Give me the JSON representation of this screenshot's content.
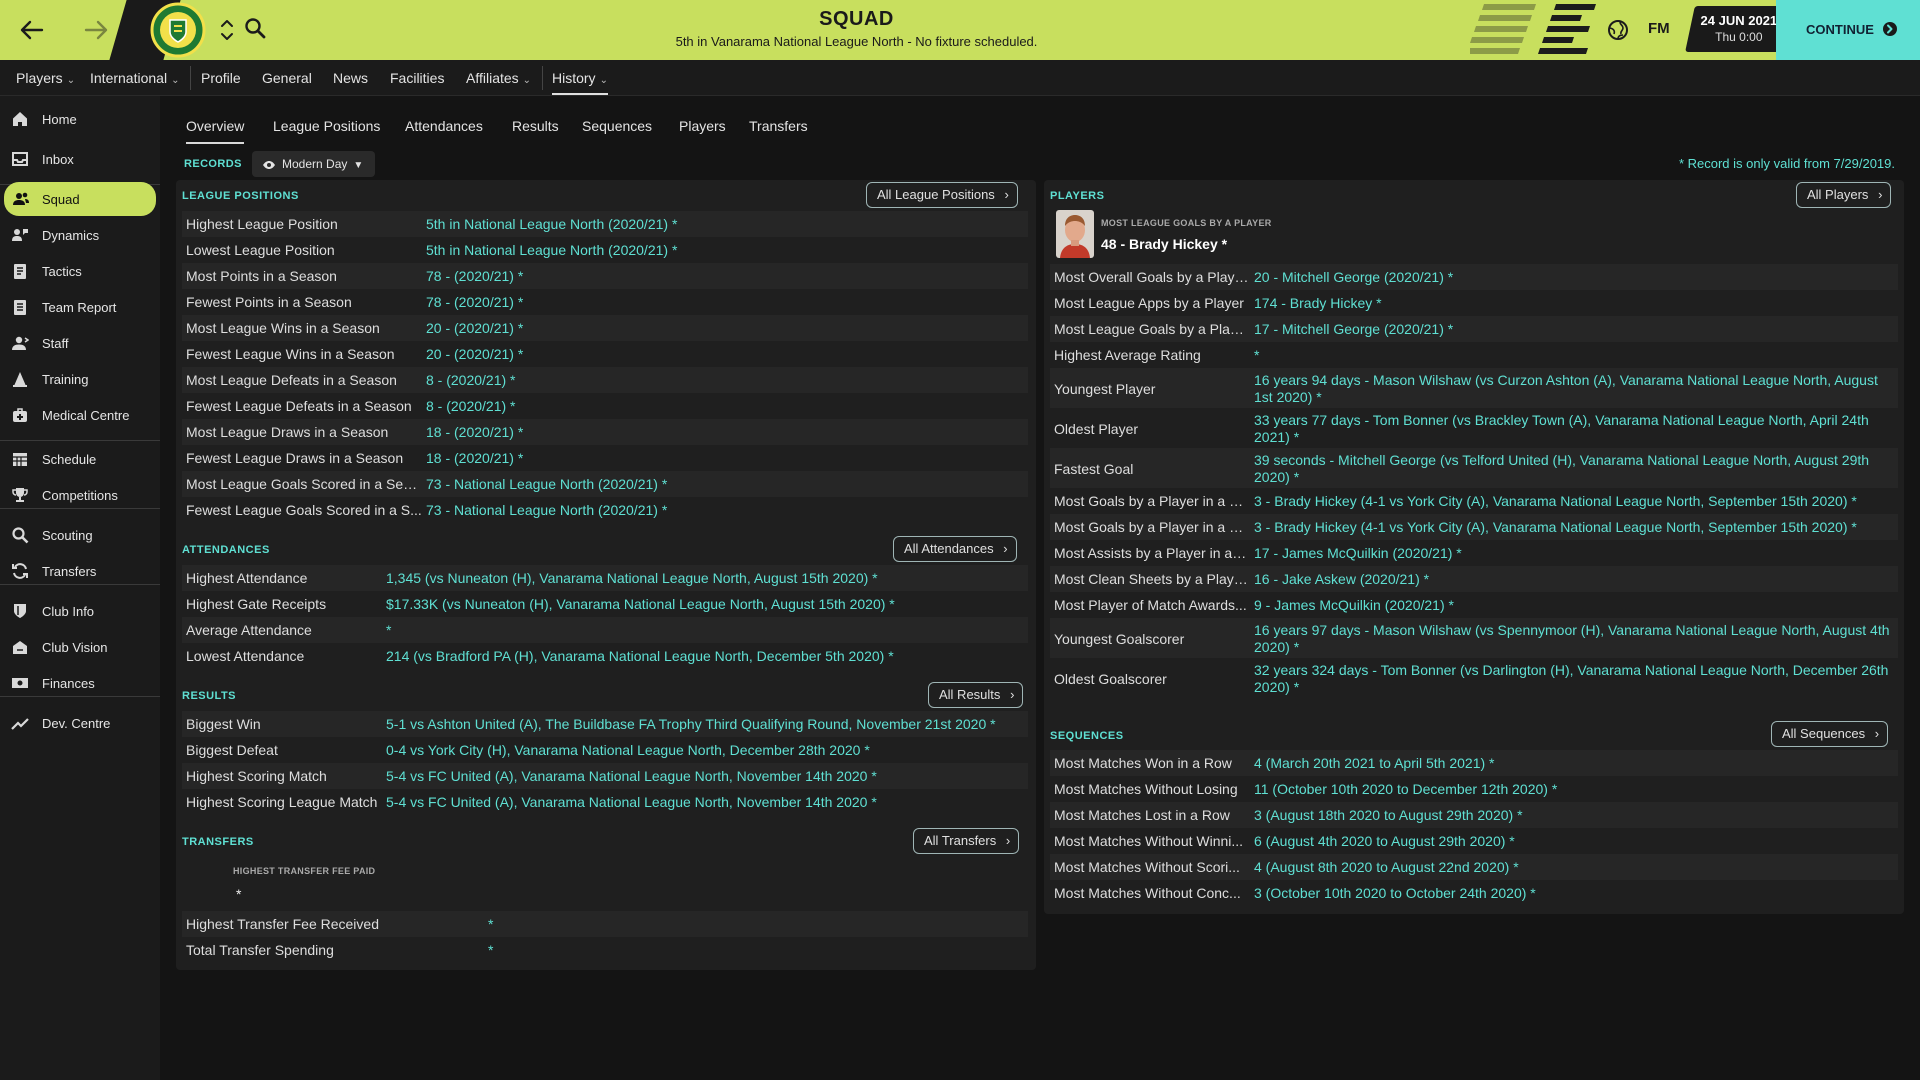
{
  "topbar": {
    "title": "SQUAD",
    "subtitle": "5th in Vanarama National League North - No fixture scheduled.",
    "fm": "FM",
    "date": "24 JUN 2021",
    "time": "Thu 0:00",
    "continue_label": "CONTINUE",
    "accent": "#c8df5e",
    "continue_color": "#5fe0d3"
  },
  "menu": [
    {
      "label": "Players",
      "dropdown": true
    },
    {
      "label": "International",
      "dropdown": true
    },
    {
      "label": "Profile"
    },
    {
      "label": "General"
    },
    {
      "label": "News"
    },
    {
      "label": "Facilities"
    },
    {
      "label": "Affiliates",
      "dropdown": true
    },
    {
      "label": "History",
      "dropdown": true,
      "active": true
    }
  ],
  "sidebar": [
    {
      "label": "Home",
      "icon": "home-icon"
    },
    {
      "label": "Inbox",
      "icon": "inbox-icon"
    },
    {
      "label": "Squad",
      "icon": "squad-icon",
      "active": true
    },
    {
      "label": "Dynamics",
      "icon": "dynamics-icon"
    },
    {
      "label": "Tactics",
      "icon": "tactics-icon"
    },
    {
      "label": "Team Report",
      "icon": "report-icon"
    },
    {
      "label": "Staff",
      "icon": "staff-icon"
    },
    {
      "label": "Training",
      "icon": "training-icon"
    },
    {
      "label": "Medical Centre",
      "icon": "medical-icon"
    },
    {
      "label": "Schedule",
      "icon": "calendar-icon"
    },
    {
      "label": "Competitions",
      "icon": "trophy-icon"
    },
    {
      "label": "Scouting",
      "icon": "scouting-icon"
    },
    {
      "label": "Transfers",
      "icon": "transfers-icon"
    },
    {
      "label": "Club Info",
      "icon": "shield-icon"
    },
    {
      "label": "Club Vision",
      "icon": "vision-icon"
    },
    {
      "label": "Finances",
      "icon": "finances-icon"
    },
    {
      "label": "Dev. Centre",
      "icon": "dev-centre-icon"
    }
  ],
  "subtabs": [
    "Overview",
    "League Positions",
    "Attendances",
    "Results",
    "Sequences",
    "Players",
    "Transfers"
  ],
  "records": {
    "label": "RECORDS",
    "filter": "Modern Day",
    "note": "* Record is only valid from 7/29/2019."
  },
  "league_positions": {
    "title": "LEAGUE POSITIONS",
    "button": "All League Positions",
    "rows": [
      {
        "label": "Highest League Position",
        "value": "5th in National League North (2020/21) *"
      },
      {
        "label": "Lowest League Position",
        "value": "5th in National League North (2020/21) *"
      },
      {
        "label": "Most Points in a Season",
        "value": "78 - (2020/21) *"
      },
      {
        "label": "Fewest Points in a Season",
        "value": "78 - (2020/21) *"
      },
      {
        "label": "Most League Wins in a Season",
        "value": "20 - (2020/21) *"
      },
      {
        "label": "Fewest League Wins in a Season",
        "value": "20 - (2020/21) *"
      },
      {
        "label": "Most League Defeats in a Season",
        "value": "8 - (2020/21) *"
      },
      {
        "label": "Fewest League Defeats in a Season",
        "value": "8 - (2020/21) *"
      },
      {
        "label": "Most League Draws in a Season",
        "value": "18 - (2020/21) *"
      },
      {
        "label": "Fewest League Draws in a Season",
        "value": "18 - (2020/21) *"
      },
      {
        "label": "Most League Goals Scored in a Seas...",
        "value": "73 - National League North (2020/21) *"
      },
      {
        "label": "Fewest League Goals Scored in a S...",
        "value": "73 - National League North (2020/21) *"
      }
    ]
  },
  "attendances": {
    "title": "ATTENDANCES",
    "button": "All Attendances",
    "rows": [
      {
        "label": "Highest Attendance",
        "value": "1,345 (vs Nuneaton (H), Vanarama National League North, August 15th 2020) *"
      },
      {
        "label": "Highest Gate Receipts",
        "value": "$17.33K (vs Nuneaton (H), Vanarama National League North, August 15th 2020) *"
      },
      {
        "label": "Average Attendance",
        "value": "*"
      },
      {
        "label": "Lowest Attendance",
        "value": "214 (vs Bradford PA (H), Vanarama National League North, December 5th 2020) *"
      }
    ]
  },
  "results": {
    "title": "RESULTS",
    "button": "All Results",
    "rows": [
      {
        "label": "Biggest Win",
        "value": "5-1 vs Ashton United (A), The Buildbase FA Trophy Third Qualifying Round, November 21st 2020 *"
      },
      {
        "label": "Biggest Defeat",
        "value": "0-4 vs York City (H), Vanarama National League North, December 28th 2020 *"
      },
      {
        "label": "Highest Scoring Match",
        "value": "5-4 vs FC United (A), Vanarama National League North, November 14th 2020 *"
      },
      {
        "label": "Highest Scoring League Match",
        "value": "5-4 vs FC United (A), Vanarama National League North, November 14th 2020 *"
      }
    ]
  },
  "transfers": {
    "title": "TRANSFERS",
    "button": "All Transfers",
    "caption": "HIGHEST TRANSFER FEE PAID",
    "caption_value": "*",
    "rows": [
      {
        "label": "Highest Transfer Fee Received",
        "value": "*"
      },
      {
        "label": "Total Transfer Spending",
        "value": "*"
      }
    ]
  },
  "players": {
    "title": "PLAYERS",
    "button": "All Players",
    "caption": "MOST LEAGUE GOALS BY A PLAYER",
    "featured": "48 - Brady Hickey *",
    "rows": [
      {
        "label": "Most Overall Goals by a Playe...",
        "value": "20 - Mitchell George (2020/21) *"
      },
      {
        "label": "Most League Apps by a Player",
        "value": "174 - Brady Hickey *"
      },
      {
        "label": "Most League Goals by a Playe...",
        "value": "17 - Mitchell George (2020/21) *"
      },
      {
        "label": "Highest Average Rating",
        "value": "*"
      },
      {
        "label": "Youngest Player",
        "value": "16 years 94 days - Mason Wilshaw (vs Curzon Ashton (A), Vanarama National League North, August 1st 2020) *"
      },
      {
        "label": "Oldest Player",
        "value": "33 years 77 days - Tom Bonner (vs Brackley Town (A), Vanarama National League North, April 24th 2021) *"
      },
      {
        "label": "Fastest Goal",
        "value": "39 seconds - Mitchell George (vs Telford United (H), Vanarama National League North, August 29th 2020) *"
      },
      {
        "label": "Most Goals by a Player in a Ma...",
        "value": "3 - Brady Hickey (4-1 vs York City (A), Vanarama National League North, September 15th 2020) *"
      },
      {
        "label": "Most Goals by a Player in a Le...",
        "value": "3 - Brady Hickey (4-1 vs York City (A), Vanarama National League North, September 15th 2020) *"
      },
      {
        "label": "Most Assists by a Player in a S...",
        "value": "17 - James McQuilkin (2020/21) *"
      },
      {
        "label": "Most Clean Sheets by a Playe...",
        "value": "16 - Jake Askew (2020/21) *"
      },
      {
        "label": "Most Player of Match Awards...",
        "value": "9 - James McQuilkin (2020/21) *"
      },
      {
        "label": "Youngest Goalscorer",
        "value": "16 years 97 days - Mason Wilshaw (vs Spennymoor (H), Vanarama National League North, August 4th 2020) *"
      },
      {
        "label": "Oldest Goalscorer",
        "value": "32 years 324 days - Tom Bonner (vs Darlington (H), Vanarama National League North, December 26th 2020) *"
      }
    ]
  },
  "sequences": {
    "title": "SEQUENCES",
    "button": "All Sequences",
    "rows": [
      {
        "label": "Most Matches Won in a Row",
        "value": "4 (March 20th 2021 to April 5th 2021) *"
      },
      {
        "label": "Most Matches Without Losing",
        "value": "11 (October 10th 2020 to December 12th 2020) *"
      },
      {
        "label": "Most Matches Lost in a Row",
        "value": "3 (August 18th 2020 to August 29th 2020) *"
      },
      {
        "label": "Most Matches Without Winni...",
        "value": "6 (August 4th 2020 to August 29th 2020) *"
      },
      {
        "label": "Most Matches Without Scori...",
        "value": "4 (August 8th 2020 to August 22nd 2020) *"
      },
      {
        "label": "Most Matches Without Conc...",
        "value": "3 (October 10th 2020 to October 24th 2020) *"
      }
    ]
  }
}
